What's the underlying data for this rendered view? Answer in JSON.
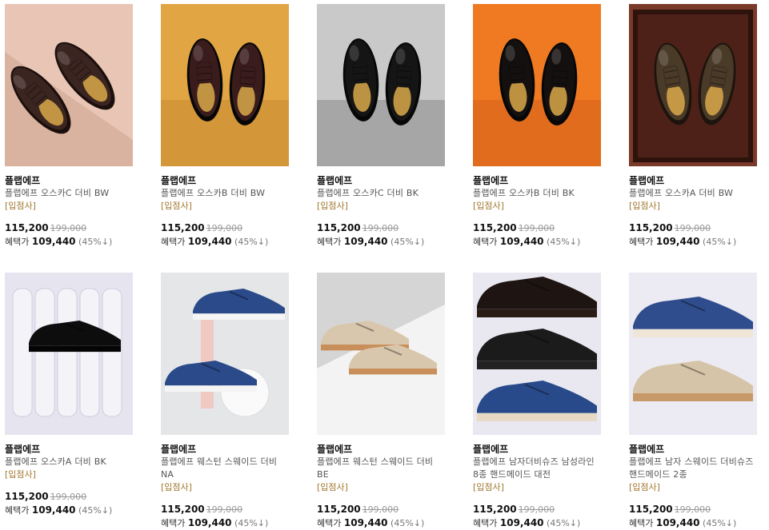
{
  "products": [
    {
      "brand": "플랩에프",
      "name": "플랩에프 오스카C 더비 BW",
      "tag": "[입점사]",
      "price": "115,200",
      "original": "199,000",
      "benefit_label": "혜택가",
      "benefit_price": "109,440",
      "discount": "(45%↓)",
      "image": "brown-derby-on-peach-diagonal",
      "colors": {
        "bg1": "#e9c5b5",
        "bg2": "#d9b2a0",
        "shoe": "#3b2520"
      }
    },
    {
      "brand": "플랩에프",
      "name": "플랩에프 오스카B 더비 BW",
      "tag": "[입점사]",
      "price": "115,200",
      "original": "199,000",
      "benefit_label": "혜택가",
      "benefit_price": "109,440",
      "discount": "(45%↓)",
      "image": "burgundy-captoe-on-mustard",
      "colors": {
        "bg1": "#e1a543",
        "bg2": "#c98d33",
        "shoe": "#3a1c1c"
      }
    },
    {
      "brand": "플랩에프",
      "name": "플랩에프 오스카C 더비 BK",
      "tag": "[입점사]",
      "price": "115,200",
      "original": "199,000",
      "benefit_label": "혜택가",
      "benefit_price": "109,440",
      "discount": "(45%↓)",
      "image": "black-derby-on-grey",
      "colors": {
        "bg1": "#c9c9c9",
        "bg2": "#8f8f8f",
        "shoe": "#151515"
      }
    },
    {
      "brand": "플랩에프",
      "name": "플랩에프 오스카B 더비 BK",
      "tag": "[입점사]",
      "price": "115,200",
      "original": "199,000",
      "benefit_label": "혜택가",
      "benefit_price": "109,440",
      "discount": "(45%↓)",
      "image": "black-captoe-on-orange",
      "colors": {
        "bg1": "#ef7a22",
        "bg2": "#d9621a",
        "shoe": "#141010"
      }
    },
    {
      "brand": "플랩에프",
      "name": "플랩에프 오스카A 더비 BW",
      "tag": "[입점사]",
      "price": "115,200",
      "original": "199,000",
      "benefit_label": "혜택가",
      "benefit_price": "109,440",
      "discount": "(45%↓)",
      "image": "brown-oxford-in-wooden-box",
      "colors": {
        "bg1": "#7a3a2a",
        "bg2": "#4e2118",
        "shoe": "#4a3a28"
      }
    },
    {
      "brand": "플랩에프",
      "name": "플랩에프 오스카A 더비 BK",
      "tag": "[입점사]",
      "price": "115,200",
      "original": "199,000",
      "benefit_label": "혜택가",
      "benefit_price": "109,440",
      "discount": "(45%↓)",
      "image": "black-oxford-on-paper-rolls",
      "colors": {
        "bg1": "#e6e4ee",
        "bg2": "#cfcde0",
        "shoe": "#0d0d0d"
      }
    },
    {
      "brand": "플랩에프",
      "name": "플랩에프 웨스턴 스웨이드 더비 NA",
      "tag": "[입점사]",
      "price": "115,200",
      "original": "199,000",
      "benefit_label": "혜택가",
      "benefit_price": "109,440",
      "discount": "(45%↓)",
      "image": "navy-suede-derby-on-pink-props",
      "colors": {
        "bg1": "#e4e6e8",
        "bg2": "#d8dadd",
        "shoe": "#2a4a8a"
      }
    },
    {
      "brand": "플랩에프",
      "name": "플랩에프 웨스턴 스웨이드 더비 BE",
      "tag": "[입점사]",
      "price": "115,200",
      "original": "199,000",
      "benefit_label": "혜택가",
      "benefit_price": "109,440",
      "discount": "(45%↓)",
      "image": "beige-suede-derby-on-white-cube",
      "colors": {
        "bg1": "#d5d5d5",
        "bg2": "#f3f3f3",
        "shoe": "#d9c7ad"
      }
    },
    {
      "brand": "플랩에프",
      "name": "플랩에프 남자더비슈즈 남성라인 8종 핸드메이드 대전",
      "tag": "[입점사]",
      "price": "115,200",
      "original": "199,000",
      "benefit_label": "혜택가",
      "benefit_price": "109,440",
      "discount": "(45%↓)",
      "image": "three-derby-shoes-stacked",
      "colors": {
        "bg1": "#e9e8f1",
        "bg2": "#dddce8",
        "shoe": "#1b1b1b"
      }
    },
    {
      "brand": "플랩에프",
      "name": "플랩에프 남자 스웨이드 더비슈즈 핸드메이드 2종",
      "tag": "[입점사]",
      "price": "115,200",
      "original": "199,000",
      "benefit_label": "혜택가",
      "benefit_price": "109,440",
      "discount": "(45%↓)",
      "image": "navy-and-beige-suede-derby",
      "colors": {
        "bg1": "#ecebf3",
        "bg2": "#e2e1ec",
        "shoe": "#2f4c8c"
      }
    }
  ]
}
